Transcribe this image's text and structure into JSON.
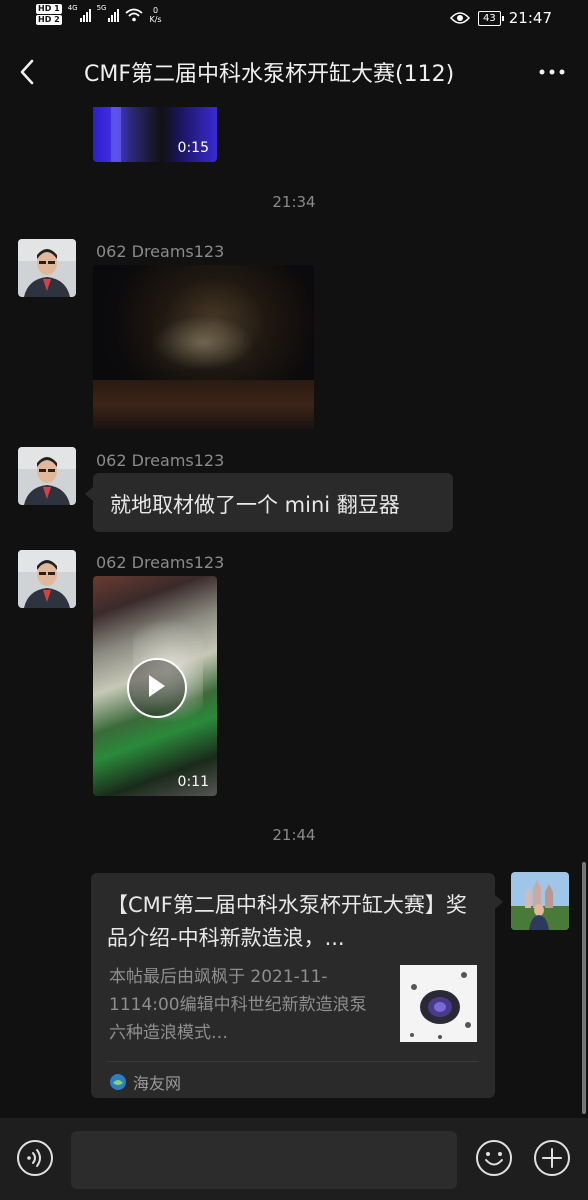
{
  "status_bar": {
    "hd1": "HD 1",
    "hd2": "HD 2",
    "net1": "4G",
    "net2": "5G",
    "speed_value": "0",
    "speed_unit": "K/s",
    "battery": "43",
    "time": "21:47"
  },
  "header": {
    "title": "CMF第二届中科水泵杯开缸大赛(112)"
  },
  "messages": {
    "top_video_duration": "0:15",
    "timestamp_1": "21:34",
    "msg1_sender": "062 Dreams123",
    "msg2_sender": "062 Dreams123",
    "msg2_text": "就地取材做了一个 mini 翻豆器",
    "msg3_sender": "062 Dreams123",
    "msg3_video_duration": "0:11",
    "timestamp_2": "21:44"
  },
  "link_card": {
    "title": "【CMF第二届中科水泵杯开缸大赛】奖品介绍-中科新款造浪，...",
    "description": "本帖最后由飒枫于 2021-11-1114:00编辑中科世纪新款造浪泵六种造浪模式…",
    "source": "海友网"
  },
  "colors": {
    "background": "#111111",
    "bubble": "#2a2a2a",
    "muted_text": "#8a8a8a"
  },
  "icons": [
    "back-arrow-icon",
    "more-options-icon",
    "play-icon",
    "voice-icon",
    "emoji-icon",
    "plus-icon",
    "eye-icon",
    "wifi-icon"
  ]
}
